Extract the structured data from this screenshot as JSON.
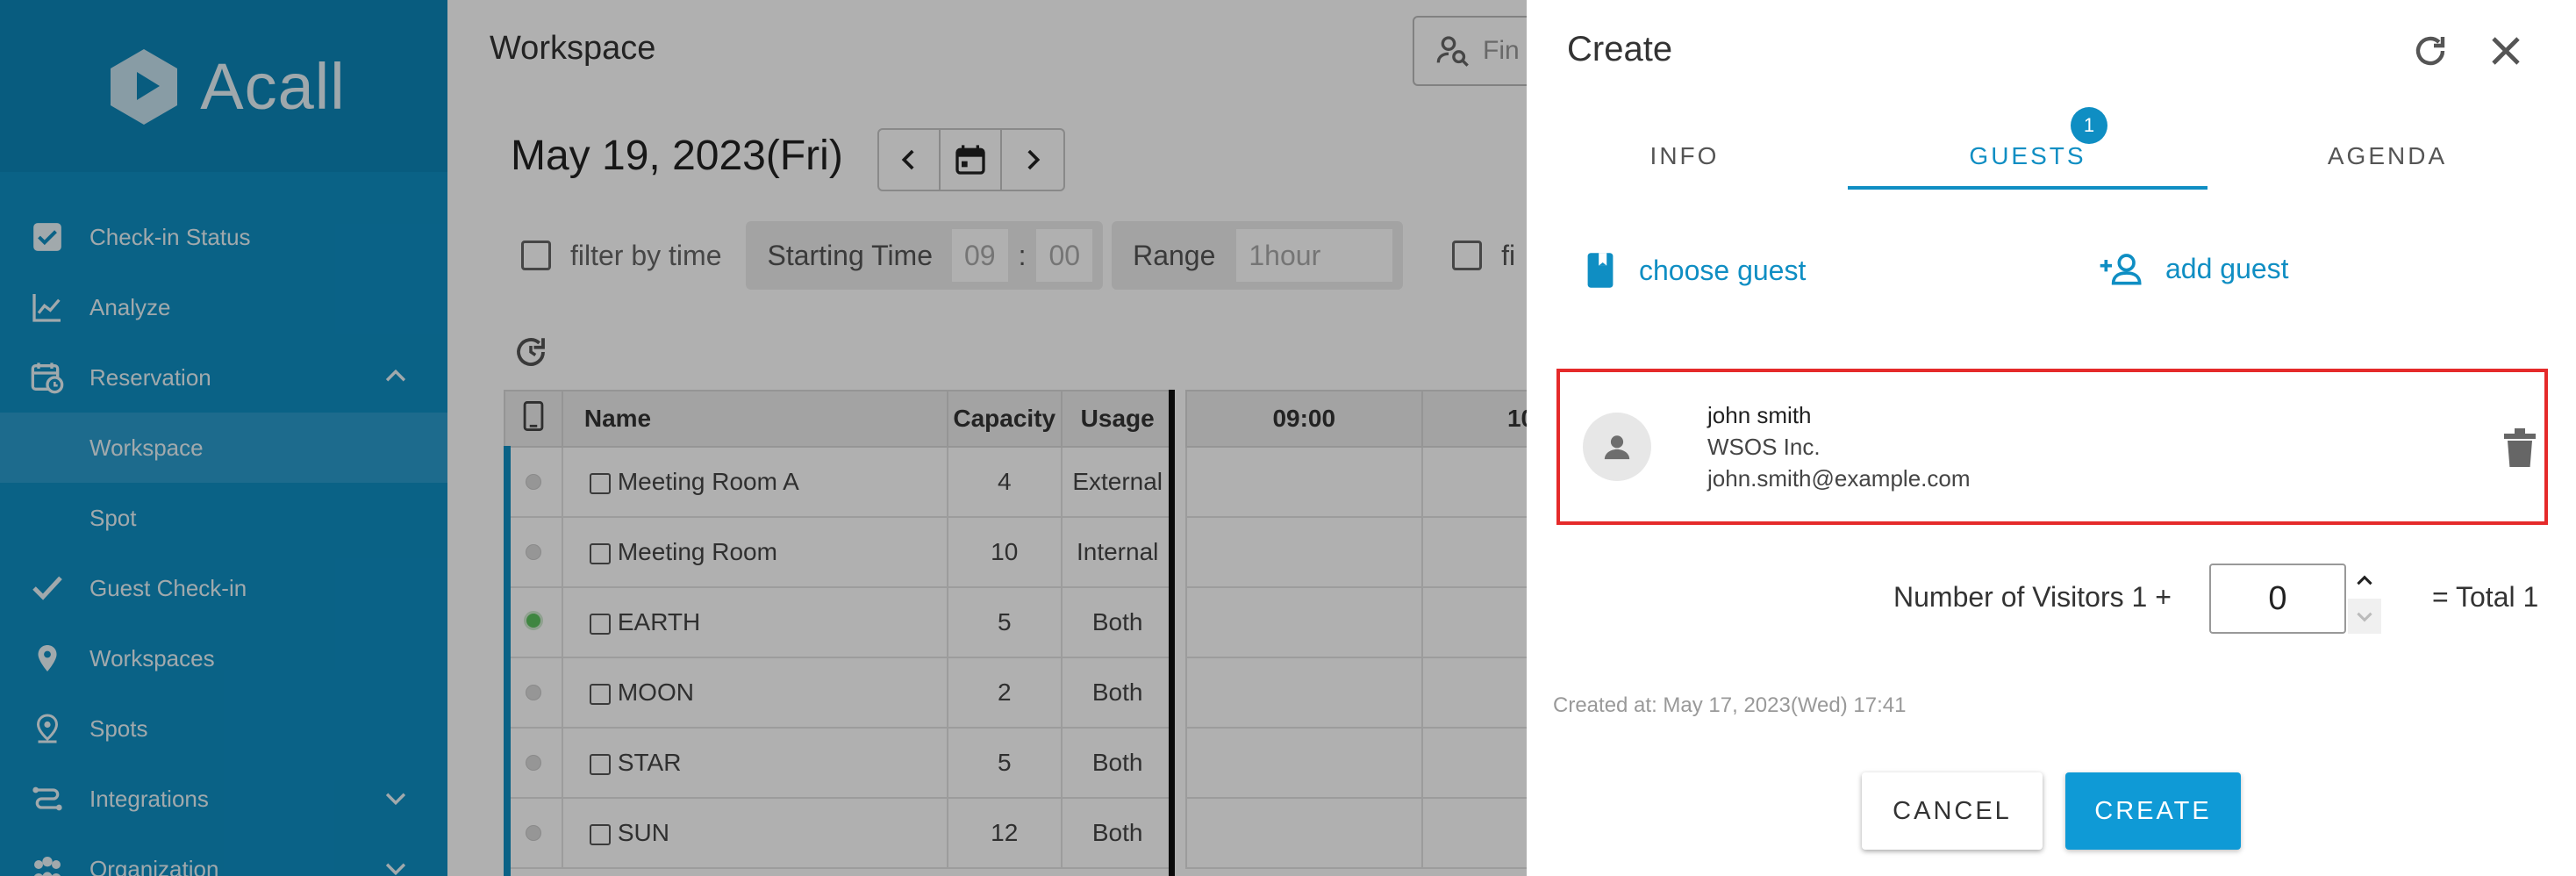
{
  "colors": {
    "brand": "#0f8ec3",
    "highlight_border": "#e52a2a",
    "primary_button": "#0f9ad6"
  },
  "sidebar": {
    "logo_text": "Acall",
    "items": [
      {
        "label": "Check-in Status",
        "icon": "checkbox-icon"
      },
      {
        "label": "Analyze",
        "icon": "line-chart-icon"
      },
      {
        "label": "Reservation",
        "icon": "calendar-clock-icon"
      },
      {
        "label": "Workspace",
        "icon": ""
      },
      {
        "label": "Spot",
        "icon": ""
      },
      {
        "label": "Guest Check-in",
        "icon": "checkmark-icon"
      },
      {
        "label": "Workspaces",
        "icon": "location-pin-icon"
      },
      {
        "label": "Spots",
        "icon": "location-pin-icon"
      },
      {
        "label": "Integrations",
        "icon": "integrations-icon"
      },
      {
        "label": "Organization",
        "icon": "people-icon"
      }
    ]
  },
  "main": {
    "title": "Workspace",
    "search_placeholder": "Fin",
    "date": "May 19, 2023(Fri)",
    "filter_by_time_label": "filter by time",
    "starting_time_label": "Starting Time",
    "start_hour": "09",
    "time_sep": ":",
    "start_minute": "00",
    "range_label": "Range",
    "range_value": "1hour",
    "second_filter_label": "fi",
    "table": {
      "headers": [
        "Name",
        "Capacity",
        "Usage"
      ],
      "time_headers": [
        "09:00",
        "10"
      ],
      "rows": [
        {
          "name": "Meeting Room A",
          "capacity": "4",
          "usage": "External",
          "status": "grey"
        },
        {
          "name": "Meeting Room",
          "capacity": "10",
          "usage": "Internal",
          "status": "grey"
        },
        {
          "name": "EARTH",
          "capacity": "5",
          "usage": "Both",
          "status": "green"
        },
        {
          "name": "MOON",
          "capacity": "2",
          "usage": "Both",
          "status": "grey"
        },
        {
          "name": "STAR",
          "capacity": "5",
          "usage": "Both",
          "status": "grey"
        },
        {
          "name": "SUN",
          "capacity": "12",
          "usage": "Both",
          "status": "grey"
        }
      ]
    }
  },
  "dialog": {
    "title": "Create",
    "tabs": {
      "info": "INFO",
      "guests": "GUESTS",
      "agenda": "AGENDA"
    },
    "guests_badge": "1",
    "choose_guest": "choose guest",
    "add_guest": "add guest",
    "guest": {
      "name": "john smith",
      "company": "WSOS Inc.",
      "email": "john.smith@example.com"
    },
    "visitors_label": "Number of Visitors 1 +",
    "visitors_value": "0",
    "total_label": "= Total 1",
    "created_at": "Created at: May 17, 2023(Wed) 17:41",
    "cancel_label": "CANCEL",
    "create_label": "CREATE"
  }
}
